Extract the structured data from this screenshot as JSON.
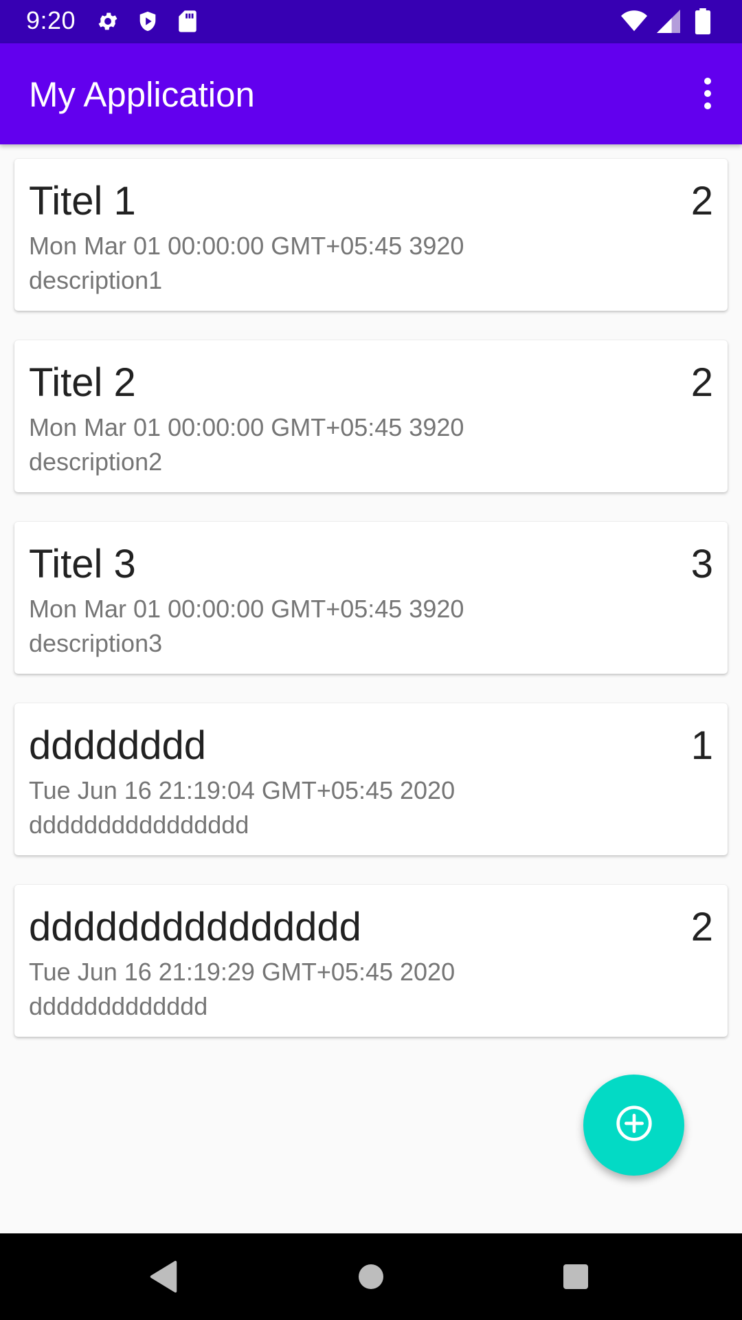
{
  "status_bar": {
    "time": "9:20",
    "left_icons": [
      "gear-icon",
      "shield-play-icon",
      "sd-card-icon"
    ],
    "right_icons": [
      "wifi-icon",
      "cell-signal-icon",
      "battery-icon"
    ]
  },
  "app_bar": {
    "title": "My Application",
    "menu_icon": "more-vert-icon",
    "color": "#6200ee"
  },
  "notes": [
    {
      "title": "Titel 1",
      "priority": "2",
      "date": "Mon Mar 01 00:00:00 GMT+05:45 3920",
      "description": "description1"
    },
    {
      "title": "Titel 2",
      "priority": "2",
      "date": "Mon Mar 01 00:00:00 GMT+05:45 3920",
      "description": "description2"
    },
    {
      "title": "Titel 3",
      "priority": "3",
      "date": "Mon Mar 01 00:00:00 GMT+05:45 3920",
      "description": "description3"
    },
    {
      "title": "dddddddd",
      "priority": "1",
      "date": "Tue Jun 16 21:19:04 GMT+05:45 2020",
      "description": "dddddddddddddddd"
    },
    {
      "title": "ddddddddddddddd",
      "priority": "2",
      "date": "Tue Jun 16 21:19:29 GMT+05:45 2020",
      "description": "ddddddddddddd"
    }
  ],
  "fab": {
    "icon": "add-circle-icon",
    "color": "#03dac5"
  },
  "nav_bar": {
    "buttons": [
      "back-icon",
      "home-icon",
      "recents-icon"
    ]
  },
  "colors": {
    "status_bar": "#3700b3",
    "primary": "#6200ee",
    "accent": "#03dac5"
  }
}
